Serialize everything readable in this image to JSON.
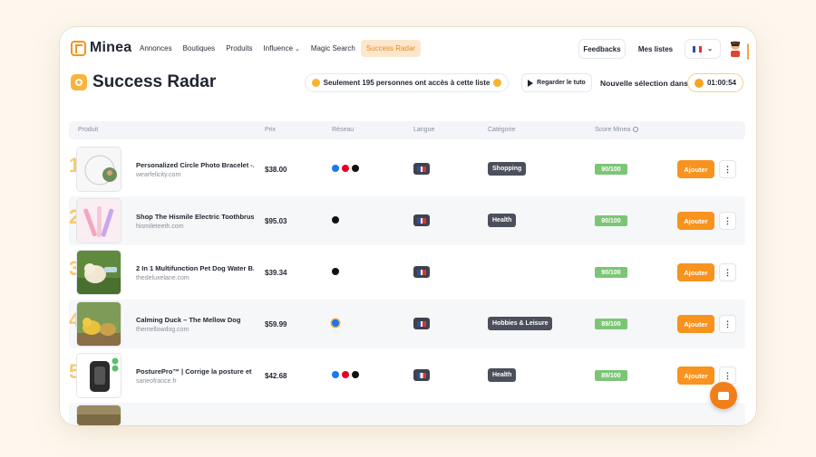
{
  "app": {
    "name": "Minea"
  },
  "nav": {
    "links": [
      {
        "label": "Annonces"
      },
      {
        "label": "Boutiques"
      },
      {
        "label": "Produits"
      },
      {
        "label": "Influence"
      },
      {
        "label": "Magic Search"
      },
      {
        "label": "Success Radar",
        "active": true
      }
    ],
    "feedbacks_label": "Feedbacks",
    "lists_label": "Mes listes",
    "language": "fr"
  },
  "header": {
    "title": "Success Radar",
    "notice": "Seulement 195 personnes ont accès à cette liste",
    "tutorial_label": "Regarder le tuto",
    "next_selection_label": "Nouvelle sélection dans:",
    "countdown": "01:00:54"
  },
  "table": {
    "columns": {
      "product": "Produit",
      "price": "Prix",
      "network": "Réseau",
      "language": "Langue",
      "category": "Catégorie",
      "score": "Score Minea"
    },
    "add_label": "Ajouter",
    "more_label": "⋮",
    "rows": [
      {
        "rank": "1",
        "name": "Personalized Circle Photo Bracelet -...",
        "domain": "wearfelicity.com",
        "price": "$38.00",
        "networks": [
          "facebook-icon",
          "pinterest-icon",
          "tiktok-icon"
        ],
        "lang": "en",
        "category": "Shopping",
        "score": "90/100"
      },
      {
        "rank": "2",
        "name": "Shop The Hismile Electric Toothbrus...",
        "domain": "hismileteeth.com",
        "price": "$95.03",
        "networks": [
          "tiktok-icon"
        ],
        "lang": "en",
        "category": "Health",
        "score": "90/100"
      },
      {
        "rank": "3",
        "name": "2 In 1 Multifunction Pet Dog Water B...",
        "domain": "thedeluxelane.com",
        "price": "$39.34",
        "networks": [
          "tiktok-icon"
        ],
        "lang": "en",
        "category": "",
        "score": "90/100"
      },
      {
        "rank": "4",
        "name": "Calming Duck – The Mellow Dog",
        "domain": "themellowdog.com",
        "price": "$59.99",
        "networks": [
          "facebook-icon"
        ],
        "lang": "en",
        "category": "Hobbies & Leisure",
        "score": "89/100"
      },
      {
        "rank": "5",
        "name": "PosturePro™ | Corrige la posture et s...",
        "domain": "saneofrance.fr",
        "price": "$42.68",
        "networks": [
          "facebook-icon",
          "pinterest-icon",
          "tiktok-icon"
        ],
        "lang": "fr",
        "category": "Health",
        "score": "89/100"
      }
    ]
  },
  "colors": {
    "accent": "#f7931e",
    "score_green": "#7cc576",
    "category_bg": "#4b505c",
    "rank_gold": "#f7c96a"
  }
}
